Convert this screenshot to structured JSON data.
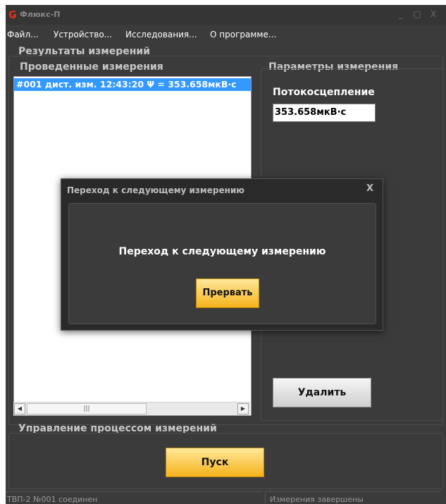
{
  "window": {
    "title": "Флюкс-П",
    "icon": "app-logo-icon",
    "controls": {
      "minimize": "_",
      "maximize": "□",
      "close": "X"
    }
  },
  "menu": [
    "Файл...",
    "Устройство...",
    "Исследования...",
    "О программе..."
  ],
  "results_group": {
    "title": "Результаты измерений",
    "measurements": {
      "title": "Проведенные измерения",
      "items": [
        "#001 дист. изм. 12:43:20 Ψ = 353.658мкВ·с"
      ],
      "scroll": {
        "left": "◀",
        "thumb": "|||",
        "right": "▶"
      }
    },
    "params": {
      "title": "Параметры измерения",
      "flux_label": "Потокосцепление",
      "flux_value": "353.658мкВ·с",
      "delete_button": "Удалить"
    }
  },
  "control_group": {
    "title": "Управление процессом измерений",
    "start_button": "Пуск"
  },
  "status": {
    "left": "ТВП-2 №001 соединен",
    "right": "Измерения завершены"
  },
  "dialog": {
    "title": "Переход к следующему измерению",
    "close": "X",
    "message": "Переход к следующему измерению",
    "abort_button": "Прервать"
  },
  "colors": {
    "accent": "#3399ff",
    "button_yellow": "#f6b21c",
    "window_bg": "#3b3b3b",
    "logo_red": "#e0301e"
  }
}
